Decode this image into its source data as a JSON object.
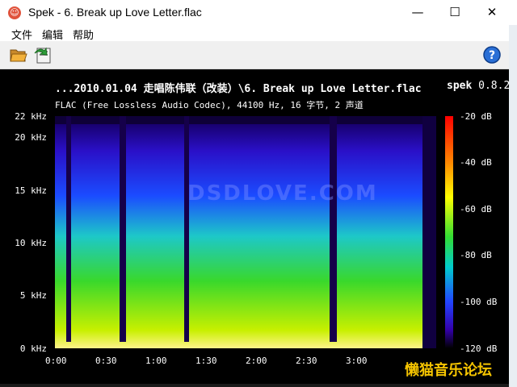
{
  "window": {
    "title": "Spek - 6. Break up Love Letter.flac",
    "app_icon": "spek-icon",
    "min_label": "—",
    "max_label": "☐",
    "close_label": "✕"
  },
  "menu": [
    "文件",
    "编辑",
    "帮助"
  ],
  "toolbar": {
    "open_icon": "folder-open-icon",
    "save_icon": "save-export-icon",
    "help_icon": "help-icon"
  },
  "header": {
    "path": "...2010.01.04 走唱陈伟联（改装）\\6. Break up Love Letter.flac",
    "app_name": "spek",
    "version": "0.8.2",
    "info": "FLAC (Free Lossless Audio Codec), 44100 Hz, 16 字节, 2 声道"
  },
  "chart_data": {
    "type": "heatmap",
    "title": "",
    "x_ticks": [
      "0:00",
      "0:30",
      "1:00",
      "1:30",
      "2:00",
      "2:30",
      "3:00"
    ],
    "x_tick_positions_sec": [
      0,
      30,
      60,
      90,
      120,
      150,
      180
    ],
    "y_ticks": [
      "0 kHz",
      "5 kHz",
      "10 kHz",
      "15 kHz",
      "20 kHz",
      "22 kHz"
    ],
    "y_tick_values_khz": [
      0,
      5,
      10,
      15,
      20,
      22
    ],
    "colorbar_ticks": [
      "-20 dB",
      "-40 dB",
      "-60 dB",
      "-80 dB",
      "-100 dB",
      "-120 dB"
    ],
    "colorbar_values_db": [
      -20,
      -40,
      -60,
      -80,
      -100,
      -120
    ],
    "ylim_khz": [
      0,
      22
    ],
    "clim_db": [
      -120,
      -20
    ],
    "duration_sec": 228
  },
  "watermarks": {
    "overlay": "DSDLOVE.COM",
    "corner": "懒猫音乐论坛"
  },
  "colors": {
    "background": "#000000",
    "text": "#ffffff",
    "accent": "#f5c400"
  }
}
